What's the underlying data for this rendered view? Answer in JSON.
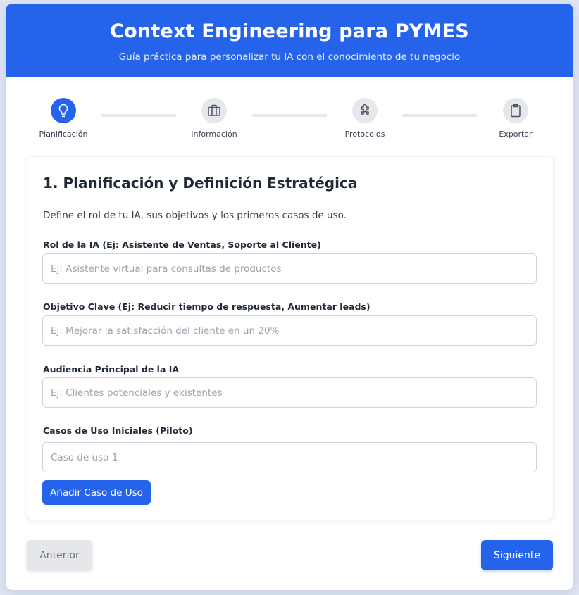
{
  "header": {
    "title": "Context Engineering para PYMES",
    "subtitle": "Guía práctica para personalizar tu IA con el conocimiento de tu negocio"
  },
  "steps": [
    {
      "label": "Planificación",
      "icon": "lightbulb-icon",
      "active": true
    },
    {
      "label": "Información",
      "icon": "briefcase-icon",
      "active": false
    },
    {
      "label": "Protocolos",
      "icon": "puzzle-icon",
      "active": false
    },
    {
      "label": "Exportar",
      "icon": "clipboard-icon",
      "active": false
    }
  ],
  "colors": {
    "accent": "#2563eb",
    "inactive_step": "#e5e7eb"
  },
  "section": {
    "title": "1. Planificación y Definición Estratégica",
    "description": "Define el rol de tu IA, sus objetivos y los primeros casos de uso.",
    "fields": [
      {
        "label": "Rol de la IA (Ej: Asistente de Ventas, Soporte al Cliente)",
        "value": "",
        "placeholder": "Ej: Asistente virtual para consultas de productos"
      },
      {
        "label": "Objetivo Clave (Ej: Reducir tiempo de respuesta, Aumentar leads)",
        "value": "",
        "placeholder": "Ej: Mejorar la satisfacción del cliente en un 20%"
      },
      {
        "label": "Audiencia Principal de la IA",
        "value": "",
        "placeholder": "Ej: Clientes potenciales y existentes"
      },
      {
        "label": "Casos de Uso Iniciales (Piloto)",
        "value": "",
        "placeholder": "Caso de uso 1"
      }
    ],
    "add_button": "Añadir Caso de Uso"
  },
  "nav": {
    "prev": "Anterior",
    "next": "Siguiente"
  }
}
